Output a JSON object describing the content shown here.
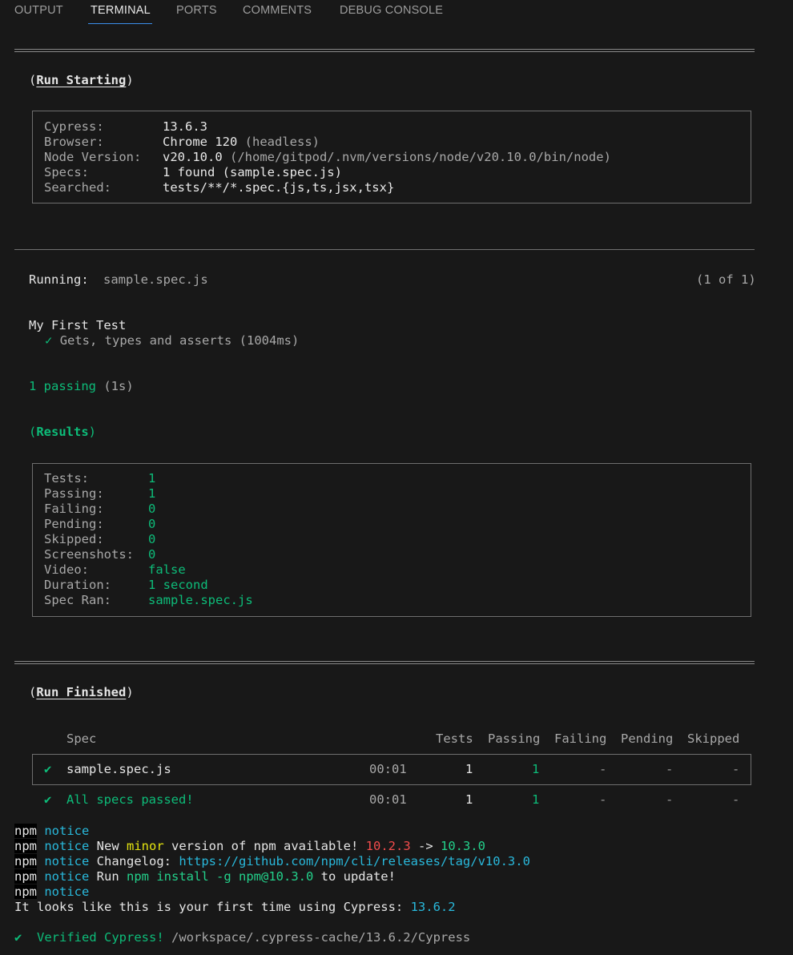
{
  "tabs": [
    {
      "label": "OUTPUT",
      "active": false
    },
    {
      "label": "TERMINAL",
      "active": true
    },
    {
      "label": "PORTS",
      "active": false
    },
    {
      "label": "COMMENTS",
      "active": false
    },
    {
      "label": "DEBUG CONSOLE",
      "active": false
    }
  ],
  "run_starting": {
    "open": "(",
    "title": "Run Starting",
    "close": ")",
    "rows": [
      {
        "key": "Cypress:",
        "value": "13.6.3",
        "extra": ""
      },
      {
        "key": "Browser:",
        "value": "Chrome 120",
        "extra": " (headless)"
      },
      {
        "key": "Node Version:",
        "value": "v20.10.0",
        "extra": " (/home/gitpod/.nvm/versions/node/v20.10.0/bin/node)"
      },
      {
        "key": "Specs:",
        "value": "1 found (sample.spec.js)",
        "extra": ""
      },
      {
        "key": "Searched:",
        "value": "tests/**/*.spec.{js,ts,jsx,tsx}",
        "extra": ""
      }
    ]
  },
  "running": {
    "label": "Running:",
    "spec": "sample.spec.js",
    "count": "(1 of 1)"
  },
  "suite": {
    "name": "My First Test",
    "check": "✓",
    "test": "Gets, types and asserts",
    "duration": "(1004ms)"
  },
  "passing": {
    "text": "1 passing",
    "time": "(1s)"
  },
  "results": {
    "open": "(",
    "title": "Results",
    "close": ")",
    "rows": [
      {
        "key": "Tests:",
        "value": "1"
      },
      {
        "key": "Passing:",
        "value": "1"
      },
      {
        "key": "Failing:",
        "value": "0"
      },
      {
        "key": "Pending:",
        "value": "0"
      },
      {
        "key": "Skipped:",
        "value": "0"
      },
      {
        "key": "Screenshots:",
        "value": "0"
      },
      {
        "key": "Video:",
        "value": "false"
      },
      {
        "key": "Duration:",
        "value": "1 second"
      },
      {
        "key": "Spec Ran:",
        "value": "sample.spec.js"
      }
    ]
  },
  "run_finished": {
    "open": "(",
    "title": "Run Finished",
    "close": ")",
    "headers": {
      "spec": "Spec",
      "tests": "Tests",
      "passing": "Passing",
      "failing": "Failing",
      "pending": "Pending",
      "skipped": "Skipped"
    },
    "row": {
      "check": "✔",
      "spec": "sample.spec.js",
      "time": "00:01",
      "tests": "1",
      "passing": "1",
      "failing": "-",
      "pending": "-",
      "skipped": "-"
    },
    "total": {
      "check": "✔",
      "label": "All specs passed!",
      "time": "00:01",
      "tests": "1",
      "passing": "1",
      "failing": "-",
      "pending": "-",
      "skipped": "-"
    }
  },
  "npm": {
    "prefix": "npm",
    "notice": "notice",
    "l2": {
      "a": " New ",
      "b": "minor",
      "c": " version of npm available! ",
      "old": "10.2.3",
      "arrow": " -> ",
      "new": "10.3.0"
    },
    "l3": {
      "a": " Changelog: ",
      "url": "https://github.com/npm/cli/releases/tag/v10.3.0"
    },
    "l4": {
      "a": " Run ",
      "cmd": "npm install -g npm@10.3.0",
      "b": " to update!"
    }
  },
  "first_time": {
    "text": "It looks like this is your first time using Cypress: ",
    "version": "13.6.2"
  },
  "verified": {
    "check": "✔",
    "text": "  Verified Cypress!",
    "path": " /workspace/.cypress-cache/13.6.2/Cypress"
  }
}
